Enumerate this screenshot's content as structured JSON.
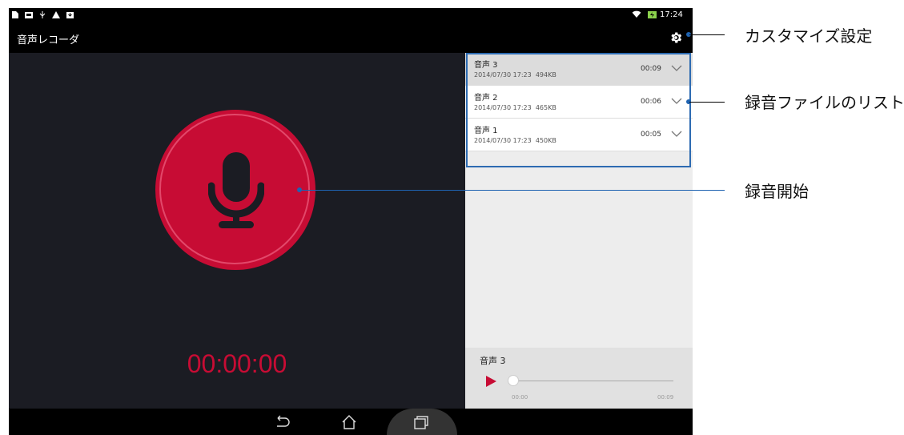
{
  "status_bar": {
    "time": "17:24",
    "left_icons": [
      "document-icon",
      "image-icon",
      "usb-icon",
      "warning-icon",
      "download-icon"
    ],
    "right_icons": [
      "wifi-icon",
      "battery-charging-icon"
    ]
  },
  "action_bar": {
    "title": "音声レコーダ",
    "settings_icon": "gear-icon"
  },
  "recorder": {
    "timer": "00:00:00",
    "mic_icon": "microphone-icon",
    "accent": "#c70c34"
  },
  "recordings": [
    {
      "name": "音声 3",
      "date": "2014/07/30 17:23",
      "size": "494KB",
      "duration": "00:09",
      "selected": true
    },
    {
      "name": "音声 2",
      "date": "2014/07/30 17:23",
      "size": "465KB",
      "duration": "00:06",
      "selected": false
    },
    {
      "name": "音声 1",
      "date": "2014/07/30 17:23",
      "size": "450KB",
      "duration": "00:05",
      "selected": false
    }
  ],
  "player": {
    "name": "音声 3",
    "position": "00:00",
    "length": "00:09",
    "progress": 0
  },
  "nav_bar": {
    "buttons": [
      "back-icon",
      "home-icon",
      "recent-apps-icon"
    ]
  },
  "annotations": {
    "settings": "カスタマイズ設定",
    "list": "録音ファイルのリスト",
    "record": "録音開始",
    "line_color": "#1f63b1"
  }
}
